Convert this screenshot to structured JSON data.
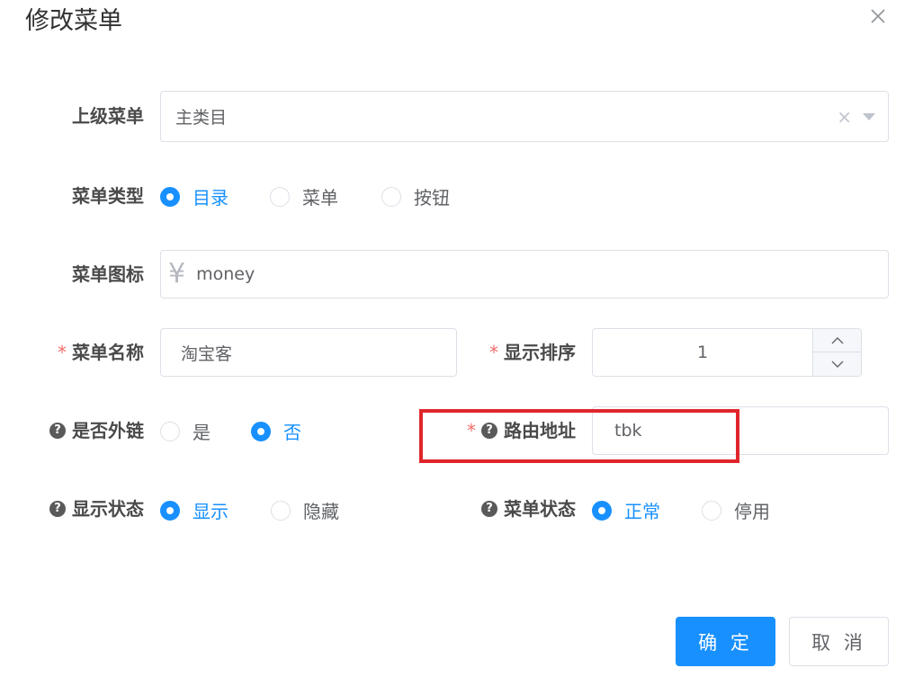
{
  "dialog": {
    "title": "修改菜单"
  },
  "form": {
    "parent_menu": {
      "label": "上级菜单",
      "value": "主类目"
    },
    "menu_type": {
      "label": "菜单类型",
      "options": [
        "目录",
        "菜单",
        "按钮"
      ],
      "selected": "目录"
    },
    "menu_icon": {
      "label": "菜单图标",
      "icon": "yen-icon",
      "value": "money"
    },
    "menu_name": {
      "label": "菜单名称",
      "required_mark": "*",
      "value": "淘宝客"
    },
    "display_order": {
      "label": "显示排序",
      "required_mark": "*",
      "value": "1"
    },
    "external_link": {
      "label": "是否外链",
      "help_mark": "?",
      "options": [
        "是",
        "否"
      ],
      "selected": "否"
    },
    "route_path": {
      "label": "路由地址",
      "required_mark": "*",
      "help_mark": "?",
      "value": "tbk"
    },
    "visible_status": {
      "label": "显示状态",
      "help_mark": "?",
      "options": [
        "显示",
        "隐藏"
      ],
      "selected": "显示"
    },
    "menu_status": {
      "label": "菜单状态",
      "help_mark": "?",
      "options": [
        "正常",
        "停用"
      ],
      "selected": "正常"
    }
  },
  "footer": {
    "confirm_label": "确 定",
    "cancel_label": "取 消"
  },
  "colors": {
    "primary": "#1890ff",
    "required": "#f56c6c",
    "highlight_box": "#e0262c"
  }
}
